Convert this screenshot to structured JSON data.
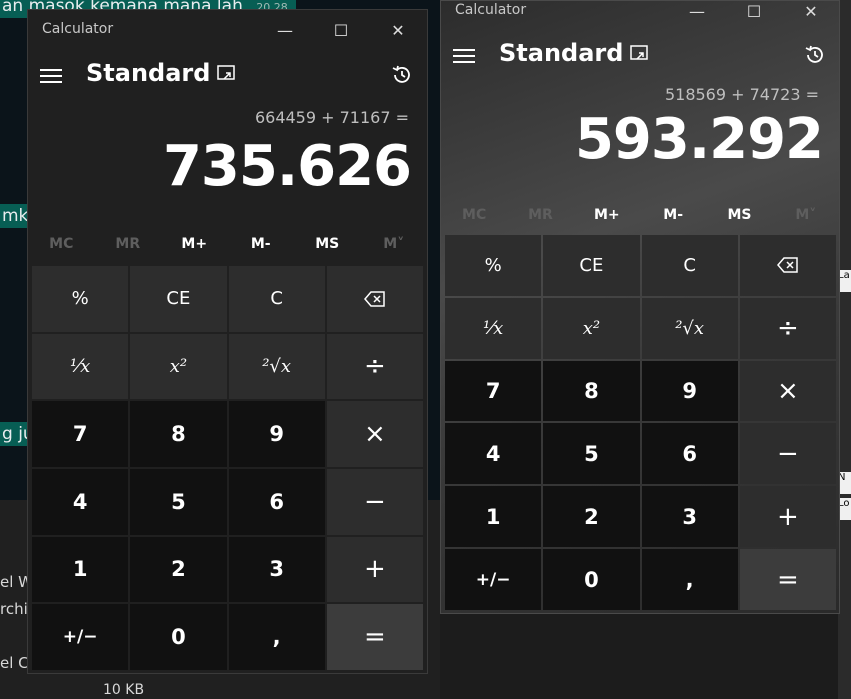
{
  "background": {
    "chat_bubbles": [
      {
        "text": "an masok kemana mana lah",
        "time": "20.28"
      },
      {
        "text": "mk"
      },
      {
        "text": "g ju"
      }
    ],
    "explorer": {
      "files": [
        "el W",
        "rchiv",
        "el Co"
      ],
      "size": "10 KB"
    },
    "right_strip": [
      "La",
      "N",
      "Lo"
    ]
  },
  "calculators": [
    {
      "title": "Calculator",
      "mode": "Standard",
      "expression": "664459 + 71167 =",
      "result": "735.626",
      "memory": [
        "MC",
        "MR",
        "M+",
        "M-",
        "MS",
        "M˅"
      ],
      "memory_enabled": [
        false,
        false,
        true,
        true,
        true,
        false
      ],
      "keys": [
        [
          "%",
          "CE",
          "C",
          "⌫"
        ],
        [
          "¹⁄x",
          "x²",
          "²√x",
          "÷"
        ],
        [
          "7",
          "8",
          "9",
          "×"
        ],
        [
          "4",
          "5",
          "6",
          "−"
        ],
        [
          "1",
          "2",
          "3",
          "+"
        ],
        [
          "+/−",
          "0",
          ",",
          "="
        ]
      ]
    },
    {
      "title": "Calculator",
      "mode": "Standard",
      "expression": "518569 + 74723 =",
      "result": "593.292",
      "memory": [
        "MC",
        "MR",
        "M+",
        "M-",
        "MS",
        "M˅"
      ],
      "memory_enabled": [
        false,
        false,
        true,
        true,
        true,
        false
      ],
      "keys": [
        [
          "%",
          "CE",
          "C",
          "⌫"
        ],
        [
          "¹⁄x",
          "x²",
          "²√x",
          "÷"
        ],
        [
          "7",
          "8",
          "9",
          "×"
        ],
        [
          "4",
          "5",
          "6",
          "−"
        ],
        [
          "1",
          "2",
          "3",
          "+"
        ],
        [
          "+/−",
          "0",
          ",",
          "="
        ]
      ]
    }
  ],
  "window_buttons": {
    "minimize": "—",
    "maximize": "☐",
    "close": "✕"
  },
  "colors": {
    "calc_bg": "#202020",
    "digit_key": "#111111",
    "op_key": "#2d2d2d",
    "equals_key": "#3c3c3c",
    "chat_bubble": "#075e54"
  }
}
